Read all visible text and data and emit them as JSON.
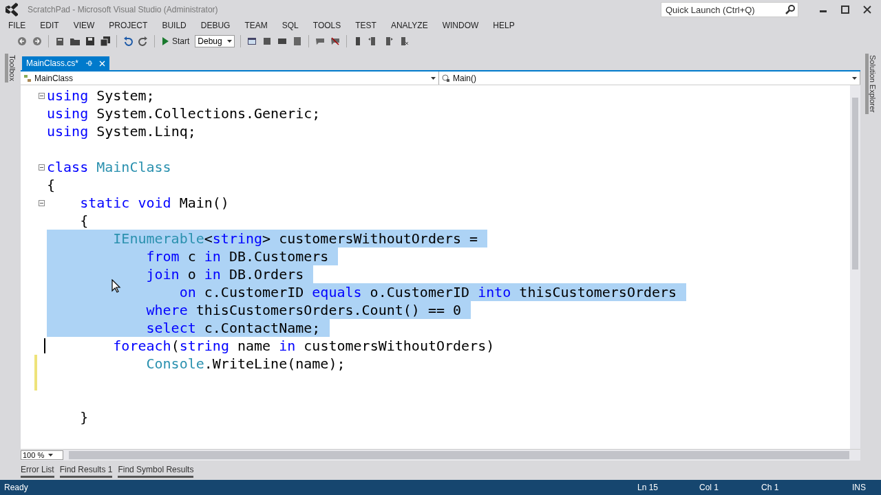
{
  "window": {
    "title": "ScratchPad - Microsoft Visual Studio (Administrator)",
    "quick_launch": {
      "placeholder": "Quick Launch (Ctrl+Q)"
    }
  },
  "menu": [
    "FILE",
    "EDIT",
    "VIEW",
    "PROJECT",
    "BUILD",
    "DEBUG",
    "TEAM",
    "SQL",
    "TOOLS",
    "TEST",
    "ANALYZE",
    "WINDOW",
    "HELP"
  ],
  "toolbar": {
    "start_label": "Start",
    "configuration": "Debug"
  },
  "side_tabs": {
    "left": "Toolbox",
    "right": "Solution Explorer"
  },
  "document_tabs": [
    {
      "label": "MainClass.cs*",
      "selected": true
    }
  ],
  "navigation": {
    "type_dropdown": "MainClass",
    "member_dropdown": "Main()"
  },
  "editor": {
    "zoom": "100 %",
    "lines": [
      {
        "tokens": [
          {
            "text": "using",
            "kind": "keyword"
          },
          {
            "text": " System;",
            "kind": "plain"
          }
        ],
        "selected": false,
        "fold": true,
        "modified": false
      },
      {
        "tokens": [
          {
            "text": "using",
            "kind": "keyword"
          },
          {
            "text": " System.Collections.Generic;",
            "kind": "plain"
          }
        ],
        "selected": false,
        "fold": false,
        "modified": false
      },
      {
        "tokens": [
          {
            "text": "using",
            "kind": "keyword"
          },
          {
            "text": " System.Linq;",
            "kind": "plain"
          }
        ],
        "selected": false,
        "fold": false,
        "modified": false
      },
      {
        "selected": false,
        "fold": false,
        "modified": false
      },
      {
        "tokens": [
          {
            "text": "class ",
            "kind": "keyword"
          },
          {
            "text": "MainClass",
            "kind": "type"
          }
        ],
        "selected": false,
        "fold": true,
        "modified": false
      },
      {
        "tokens": [
          {
            "text": "{",
            "kind": "plain"
          }
        ],
        "selected": false,
        "fold": false,
        "modified": false
      },
      {
        "tokens": [
          {
            "text": "    static ",
            "kind": "keyword"
          },
          {
            "text": "void",
            "kind": "keyword"
          },
          {
            "text": " Main()",
            "kind": "plain"
          }
        ],
        "selected": false,
        "fold": true,
        "modified": false
      },
      {
        "tokens": [
          {
            "text": "    {",
            "kind": "plain"
          }
        ],
        "selected": false,
        "fold": false,
        "modified": false
      },
      {
        "tokens": [
          {
            "text": "        IEnumerable",
            "kind": "type"
          },
          {
            "text": "<",
            "kind": "plain"
          },
          {
            "text": "string",
            "kind": "keyword"
          },
          {
            "text": "> customersWithoutOrders =",
            "kind": "plain"
          }
        ],
        "selected": true,
        "fold": false,
        "modified": false
      },
      {
        "tokens": [
          {
            "text": "            from",
            "kind": "keyword"
          },
          {
            "text": " c ",
            "kind": "plain"
          },
          {
            "text": "in",
            "kind": "keyword"
          },
          {
            "text": " DB.Customers",
            "kind": "plain"
          }
        ],
        "selected": true,
        "fold": false,
        "modified": false
      },
      {
        "tokens": [
          {
            "text": "            join",
            "kind": "keyword"
          },
          {
            "text": " o ",
            "kind": "plain"
          },
          {
            "text": "in",
            "kind": "keyword"
          },
          {
            "text": " DB.Orders",
            "kind": "plain"
          }
        ],
        "selected": true,
        "fold": false,
        "modified": false
      },
      {
        "tokens": [
          {
            "text": "                on",
            "kind": "keyword"
          },
          {
            "text": " c.CustomerID ",
            "kind": "plain"
          },
          {
            "text": "equals",
            "kind": "keyword"
          },
          {
            "text": " o.CustomerID ",
            "kind": "plain"
          },
          {
            "text": "into",
            "kind": "keyword"
          },
          {
            "text": " thisCustomersOrders",
            "kind": "plain"
          }
        ],
        "selected": true,
        "fold": false,
        "modified": false
      },
      {
        "tokens": [
          {
            "text": "            where",
            "kind": "keyword"
          },
          {
            "text": " thisCustomersOrders.Count() == 0",
            "kind": "plain"
          }
        ],
        "selected": true,
        "fold": false,
        "modified": false
      },
      {
        "tokens": [
          {
            "text": "            select",
            "kind": "keyword"
          },
          {
            "text": " c.ContactName;",
            "kind": "plain"
          }
        ],
        "selected": true,
        "fold": false,
        "modified": false
      },
      {
        "tokens": [
          {
            "kind": "caret"
          },
          {
            "text": "        foreach",
            "kind": "keyword"
          },
          {
            "text": "(",
            "kind": "plain"
          },
          {
            "text": "string",
            "kind": "keyword"
          },
          {
            "text": " name ",
            "kind": "plain"
          },
          {
            "text": "in",
            "kind": "keyword"
          },
          {
            "text": " customersWithoutOrders)",
            "kind": "plain"
          }
        ],
        "selected": false,
        "fold": false,
        "modified": false
      },
      {
        "tokens": [
          {
            "text": "            Console",
            "kind": "type"
          },
          {
            "text": ".WriteLine(name);",
            "kind": "plain"
          }
        ],
        "selected": false,
        "fold": false,
        "modified": true
      },
      {
        "selected": false,
        "fold": false,
        "modified": true
      },
      {
        "selected": false,
        "fold": false,
        "modified": false
      },
      {
        "tokens": [
          {
            "text": "    }",
            "kind": "plain"
          }
        ],
        "selected": false,
        "fold": false,
        "modified": false
      }
    ]
  },
  "tool_tabs": [
    "Error List",
    "Find Results 1",
    "Find Symbol Results"
  ],
  "status_bar": {
    "message": "Ready",
    "line": "Ln 15",
    "column": "Col 1",
    "char": "Ch 1",
    "mode": "INS"
  }
}
